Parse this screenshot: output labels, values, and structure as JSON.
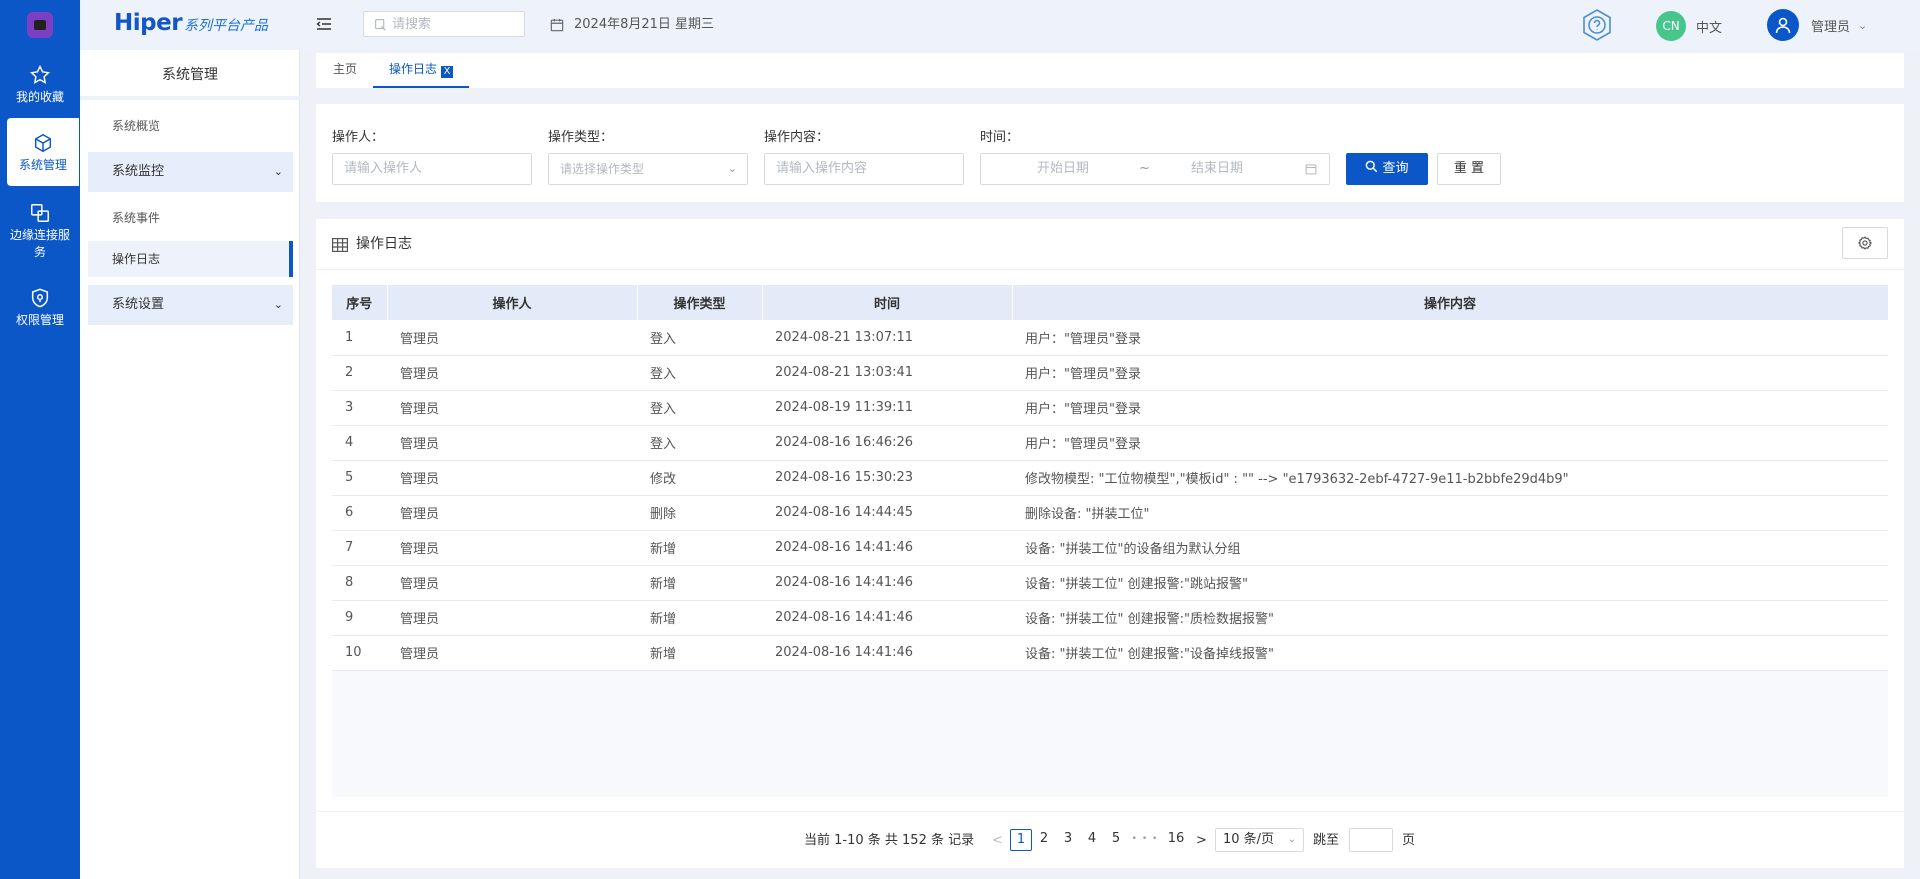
{
  "rail": {
    "items": [
      {
        "label": "我的收藏",
        "icon": "star-icon"
      },
      {
        "label": "系统管理",
        "icon": "cube-icon"
      },
      {
        "label": "边缘连接服务",
        "icon": "link-icon"
      },
      {
        "label": "权限管理",
        "icon": "shield-icon"
      }
    ]
  },
  "brand": {
    "name": "Hiper",
    "suffix": "系列平台产品"
  },
  "sidebar": {
    "title": "系统管理",
    "items": [
      {
        "label": "系统概览"
      },
      {
        "label": "系统监控"
      },
      {
        "label": "系统事件"
      },
      {
        "label": "操作日志"
      },
      {
        "label": "系统设置"
      }
    ]
  },
  "header": {
    "search_placeholder": "请搜索",
    "date": "2024年8月21日 星期三",
    "lang_badge": "CN",
    "lang_label": "中文",
    "user": "管理员"
  },
  "tabs": {
    "home": "主页",
    "current": "操作日志",
    "close": "X"
  },
  "filters": {
    "operator_label": "操作人：",
    "operator_placeholder": "请输入操作人",
    "type_label": "操作类型：",
    "type_placeholder": "请选择操作类型",
    "content_label": "操作内容：",
    "content_placeholder": "请输入操作内容",
    "time_label": "时间：",
    "start_placeholder": "开始日期",
    "range_sep": "~",
    "end_placeholder": "结束日期",
    "query_button": "查询",
    "reset_button": "重 置"
  },
  "table": {
    "title": "操作日志",
    "columns": [
      "序号",
      "操作人",
      "操作类型",
      "时间",
      "操作内容"
    ],
    "rows": [
      {
        "no": "1",
        "operator": "管理员",
        "type": "登入",
        "time": "2024-08-21 13:07:11",
        "content": "用户：\"管理员\"登录"
      },
      {
        "no": "2",
        "operator": "管理员",
        "type": "登入",
        "time": "2024-08-21 13:03:41",
        "content": "用户：\"管理员\"登录"
      },
      {
        "no": "3",
        "operator": "管理员",
        "type": "登入",
        "time": "2024-08-19 11:39:11",
        "content": "用户：\"管理员\"登录"
      },
      {
        "no": "4",
        "operator": "管理员",
        "type": "登入",
        "time": "2024-08-16 16:46:26",
        "content": "用户：\"管理员\"登录"
      },
      {
        "no": "5",
        "operator": "管理员",
        "type": "修改",
        "time": "2024-08-16 15:30:23",
        "content": "修改物模型: \"工位物模型\",\"模板id\" : \"\" --> \"e1793632-2ebf-4727-9e11-b2bbfe29d4b9\""
      },
      {
        "no": "6",
        "operator": "管理员",
        "type": "删除",
        "time": "2024-08-16 14:44:45",
        "content": "删除设备: \"拼装工位\""
      },
      {
        "no": "7",
        "operator": "管理员",
        "type": "新增",
        "time": "2024-08-16 14:41:46",
        "content": "设备: \"拼装工位\"的设备组为默认分组"
      },
      {
        "no": "8",
        "operator": "管理员",
        "type": "新增",
        "time": "2024-08-16 14:41:46",
        "content": "设备: \"拼装工位\" 创建报警:\"跳站报警\""
      },
      {
        "no": "9",
        "operator": "管理员",
        "type": "新增",
        "time": "2024-08-16 14:41:46",
        "content": "设备: \"拼装工位\" 创建报警:\"质检数据报警\""
      },
      {
        "no": "10",
        "operator": "管理员",
        "type": "新增",
        "time": "2024-08-16 14:41:46",
        "content": "设备: \"拼装工位\" 创建报警:\"设备掉线报警\""
      }
    ]
  },
  "pagination": {
    "summary": "当前 1-10 条 共 152 条 记录",
    "pages": [
      "1",
      "2",
      "3",
      "4",
      "5"
    ],
    "ellipsis": "• • •",
    "last_page": "16",
    "current_page": "1",
    "page_size": "10 条/页",
    "jump_label": "跳至",
    "page_unit": "页",
    "prev": "<",
    "next": ">"
  },
  "colors": {
    "primary": "#0b57c8",
    "lang_badge": "#46c68c"
  }
}
